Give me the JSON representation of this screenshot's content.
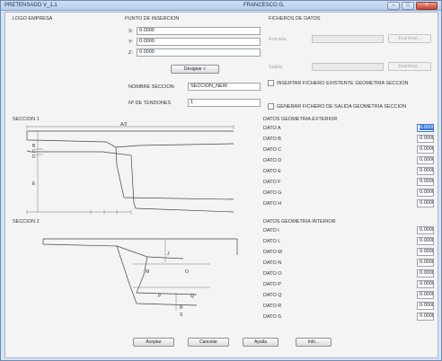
{
  "window": {
    "title": "PRETENSADO V_1.1",
    "user": "FRANCESCO G.",
    "minimize": "–",
    "maximize": "□",
    "close": "×"
  },
  "logo": {
    "label": "LOGO EMPRESA"
  },
  "insercion": {
    "heading": "PUNTO DE INSERCION",
    "x_label": "X:",
    "x_value": "0.0000",
    "y_label": "Y:",
    "y_value": "0.0000",
    "z_label": "Z:",
    "z_value": "0.0000",
    "designar_label": "Designar <",
    "nombre_label": "NOMBRE SECCION",
    "nombre_value": "SECCION_NEW",
    "tendones_label": "Nº DE TENDONES",
    "tendones_value": "1"
  },
  "ficheros": {
    "heading": "FICHEROS DE DATOS",
    "entrada_label": "Entrada",
    "entrada_value": "",
    "entrada_button": "Examinar...",
    "salida_label": "Salida",
    "salida_value": "",
    "salida_button": "Examinar...",
    "insertar_label": "INSERTAR FICHERO EXISTENTE GEOMETRIA SECCION",
    "generar_label": "GENERAR FICHERO DE SALIDA GEOMETRIA SECCION"
  },
  "seccion1": {
    "heading": "SECCION 1",
    "dims": {
      "a": "A/2",
      "b": "B",
      "c": "C",
      "d": "D",
      "e": "E",
      "f": "F",
      "g": "G",
      "h": "H"
    }
  },
  "seccion2": {
    "heading": "SECCION 2",
    "dims": {
      "j": "J",
      "m": "M",
      "o": "O",
      "p": "P",
      "q": "Q",
      "r": "R",
      "s": "S"
    }
  },
  "exterior": {
    "heading": "DATOS GEOMETRIA EXTERIOR",
    "rows": [
      {
        "label": "DATO A",
        "value": "0.0000"
      },
      {
        "label": "DATO B",
        "value": "0.0000"
      },
      {
        "label": "DATO C",
        "value": "0.0000"
      },
      {
        "label": "DATO D",
        "value": "0.0000"
      },
      {
        "label": "DATO E",
        "value": "0.0000"
      },
      {
        "label": "DATO F",
        "value": "0.0000"
      },
      {
        "label": "DATO G",
        "value": "0.0000"
      },
      {
        "label": "DATO H",
        "value": "0.0000"
      }
    ]
  },
  "interior": {
    "heading": "DATOS GEOMETRIA INTERIOR",
    "rows": [
      {
        "label": "DATO I",
        "value": "0.0000"
      },
      {
        "label": "DATO L",
        "value": "0.0000"
      },
      {
        "label": "DATO M",
        "value": "0.0000"
      },
      {
        "label": "DATO N",
        "value": "0.0000"
      },
      {
        "label": "DATO O",
        "value": "0.0000"
      },
      {
        "label": "DATO P",
        "value": "0.0000"
      },
      {
        "label": "DATO Q",
        "value": "0.0000"
      },
      {
        "label": "DATO R",
        "value": "0.0000"
      },
      {
        "label": "DATO S",
        "value": "0.0000"
      }
    ]
  },
  "footer": {
    "aceptar": "Aceptar",
    "cancelar": "Cancelar",
    "ayuda": "Ayuda",
    "info": "Info..."
  },
  "colors": {
    "accent": "#3a78d4",
    "titlebar": "#c3d6ee",
    "close": "#c8452e"
  }
}
